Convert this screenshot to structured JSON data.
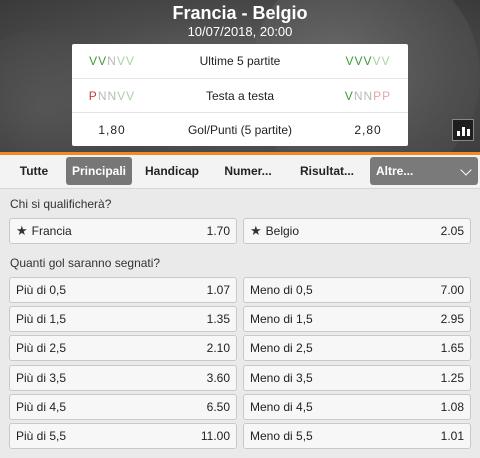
{
  "match": {
    "title": "Francia - Belgio",
    "datetime": "10/07/2018, 20:00"
  },
  "stats": [
    {
      "left": [
        {
          "r": "V",
          "faded": false
        },
        {
          "r": "V",
          "faded": false
        },
        {
          "r": "N",
          "faded": false
        },
        {
          "r": "V",
          "faded": true
        },
        {
          "r": "V",
          "faded": true
        }
      ],
      "label": "Ultime 5 partite",
      "right": [
        {
          "r": "V",
          "faded": false
        },
        {
          "r": "V",
          "faded": false
        },
        {
          "r": "V",
          "faded": false
        },
        {
          "r": "V",
          "faded": true
        },
        {
          "r": "V",
          "faded": true
        }
      ]
    },
    {
      "left": [
        {
          "r": "P",
          "faded": false
        },
        {
          "r": "N",
          "faded": false
        },
        {
          "r": "N",
          "faded": false
        },
        {
          "r": "V",
          "faded": true
        },
        {
          "r": "V",
          "faded": true
        }
      ],
      "label": "Testa a testa",
      "right": [
        {
          "r": "V",
          "faded": false
        },
        {
          "r": "N",
          "faded": false
        },
        {
          "r": "N",
          "faded": false
        },
        {
          "r": "P",
          "faded": true
        },
        {
          "r": "P",
          "faded": true
        }
      ]
    },
    {
      "left_text": "1,80",
      "label": "Gol/Punti (5 partite)",
      "right_text": "2,80"
    }
  ],
  "tabs": {
    "tutte": "Tutte",
    "principali": "Principali",
    "handicap": "Handicap",
    "numeri": "Numer...",
    "risultati": "Risultat...",
    "altre": "Altre..."
  },
  "sections": {
    "qualifica": {
      "title": "Chi si qualificherà?",
      "options": [
        {
          "label": "Francia",
          "odd": "1.70",
          "icon": "star-icon"
        },
        {
          "label": "Belgio",
          "odd": "2.05",
          "icon": "star-icon"
        }
      ]
    },
    "gol": {
      "title": "Quanti gol saranno segnati?",
      "rows": [
        {
          "over_label": "Più di 0,5",
          "over_odd": "1.07",
          "under_label": "Meno di 0,5",
          "under_odd": "7.00"
        },
        {
          "over_label": "Più di 1,5",
          "over_odd": "1.35",
          "under_label": "Meno di 1,5",
          "under_odd": "2.95"
        },
        {
          "over_label": "Più di 2,5",
          "over_odd": "2.10",
          "under_label": "Meno di 2,5",
          "under_odd": "1.65"
        },
        {
          "over_label": "Più di 3,5",
          "over_odd": "3.60",
          "under_label": "Meno di 3,5",
          "under_odd": "1.25"
        },
        {
          "over_label": "Più di 4,5",
          "over_odd": "6.50",
          "under_label": "Meno di 4,5",
          "under_odd": "1.08"
        },
        {
          "over_label": "Più di 5,5",
          "over_odd": "11.00",
          "under_label": "Meno di 5,5",
          "under_odd": "1.01"
        }
      ]
    }
  },
  "colors": {
    "accent": "#f08a24",
    "win": "#3c9a3a",
    "draw": "#b8b8b8",
    "loss": "#c43a3a"
  }
}
